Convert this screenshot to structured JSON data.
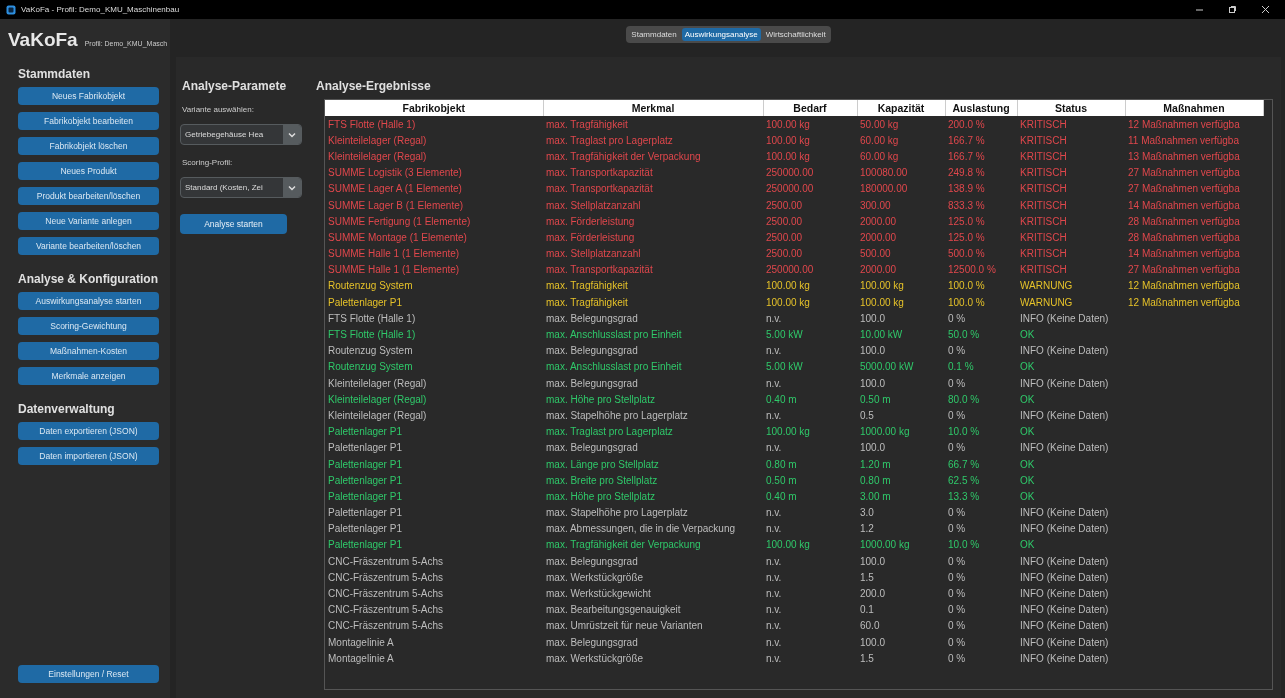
{
  "window": {
    "title": "VaKoFa - Profil: Demo_KMU_Maschinenbau"
  },
  "sidebar": {
    "app_name": "VaKoFa",
    "profile": "Profil: Demo_KMU_Masch",
    "sections": [
      {
        "title": "Stammdaten",
        "buttons": [
          "Neues Fabrikobjekt",
          "Fabrikobjekt bearbeiten",
          "Fabrikobjekt löschen",
          "Neues Produkt",
          "Produkt bearbeiten/löschen",
          "Neue Variante anlegen",
          "Variante bearbeiten/löschen"
        ]
      },
      {
        "title": "Analyse & Konfiguration",
        "buttons": [
          "Auswirkungsanalyse starten",
          "Scoring-Gewichtung",
          "Maßnahmen-Kosten",
          "Merkmale anzeigen"
        ]
      },
      {
        "title": "Datenverwaltung",
        "buttons": [
          "Daten exportieren (JSON)",
          "Daten importieren (JSON)"
        ]
      }
    ],
    "footer_button": "Einstellungen / Reset"
  },
  "tabs": [
    {
      "label": "Stammdaten",
      "selected": false
    },
    {
      "label": "Auswirkungsanalyse",
      "selected": true
    },
    {
      "label": "Wirtschaftlichkeit",
      "selected": false
    }
  ],
  "parameters": {
    "title": "Analyse-Paramete",
    "fields": [
      {
        "label": "Variante auswählen:",
        "value": "Getriebegehäuse Hea"
      },
      {
        "label": "Scoring-Profil:",
        "value": "Standard (Kosten, Zei"
      }
    ],
    "button": "Analyse starten"
  },
  "results": {
    "title": "Analyse-Ergebnisse",
    "columns": [
      "Fabrikobjekt",
      "Merkmal",
      "Bedarf",
      "Kapazität",
      "Auslastung",
      "Status",
      "Maßnahmen"
    ],
    "rows": [
      {
        "kind": "critical",
        "cells": [
          "FTS Flotte (Halle 1)",
          "max. Tragfähigkeit",
          "100.00 kg",
          "50.00 kg",
          "200.0 %",
          "KRITISCH",
          "12 Maßnahmen verfügba"
        ]
      },
      {
        "kind": "critical",
        "cells": [
          "Kleinteilelager (Regal)",
          "max. Traglast pro Lagerplatz",
          "100.00 kg",
          "60.00 kg",
          "166.7 %",
          "KRITISCH",
          "11 Maßnahmen verfügba"
        ]
      },
      {
        "kind": "critical",
        "cells": [
          "Kleinteilelager (Regal)",
          "max. Tragfähigkeit der Verpackung",
          "100.00 kg",
          "60.00 kg",
          "166.7 %",
          "KRITISCH",
          "13 Maßnahmen verfügba"
        ]
      },
      {
        "kind": "critical",
        "cells": [
          "SUMME Logistik (3 Elemente)",
          "max. Transportkapazität",
          "250000.00",
          "100080.00",
          "249.8 %",
          "KRITISCH",
          "27 Maßnahmen verfügba"
        ]
      },
      {
        "kind": "critical",
        "cells": [
          "SUMME Lager A (1 Elemente)",
          "max. Transportkapazität",
          "250000.00",
          "180000.00",
          "138.9 %",
          "KRITISCH",
          "27 Maßnahmen verfügba"
        ]
      },
      {
        "kind": "critical",
        "cells": [
          "SUMME Lager B (1 Elemente)",
          "max. Stellplatzanzahl",
          "2500.00",
          "300.00",
          "833.3 %",
          "KRITISCH",
          "14 Maßnahmen verfügba"
        ]
      },
      {
        "kind": "critical",
        "cells": [
          "SUMME Fertigung (1 Elemente)",
          "max. Förderleistung",
          "2500.00",
          "2000.00",
          "125.0 %",
          "KRITISCH",
          "28 Maßnahmen verfügba"
        ]
      },
      {
        "kind": "critical",
        "cells": [
          "SUMME Montage (1 Elemente)",
          "max. Förderleistung",
          "2500.00",
          "2000.00",
          "125.0 %",
          "KRITISCH",
          "28 Maßnahmen verfügba"
        ]
      },
      {
        "kind": "critical",
        "cells": [
          "SUMME Halle 1 (1 Elemente)",
          "max. Stellplatzanzahl",
          "2500.00",
          "500.00",
          "500.0 %",
          "KRITISCH",
          "14 Maßnahmen verfügba"
        ]
      },
      {
        "kind": "critical",
        "cells": [
          "SUMME Halle 1 (1 Elemente)",
          "max. Transportkapazität",
          "250000.00",
          "2000.00",
          "12500.0 %",
          "KRITISCH",
          "27 Maßnahmen verfügba"
        ]
      },
      {
        "kind": "warning",
        "cells": [
          "Routenzug System",
          "max. Tragfähigkeit",
          "100.00 kg",
          "100.00 kg",
          "100.0 %",
          "WARNUNG",
          "12 Maßnahmen verfügba"
        ]
      },
      {
        "kind": "warning",
        "cells": [
          "Palettenlager P1",
          "max. Tragfähigkeit",
          "100.00 kg",
          "100.00 kg",
          "100.0 %",
          "WARNUNG",
          "12 Maßnahmen verfügba"
        ]
      },
      {
        "kind": "info",
        "cells": [
          "FTS Flotte (Halle 1)",
          "max. Belegungsgrad",
          "n.v.",
          "100.0",
          "0 %",
          "INFO (Keine Daten)"
        ]
      },
      {
        "kind": "ok",
        "cells": [
          "FTS Flotte (Halle 1)",
          "max. Anschlusslast pro Einheit",
          "5.00 kW",
          "10.00 kW",
          "50.0 %",
          "OK"
        ]
      },
      {
        "kind": "info",
        "cells": [
          "Routenzug System",
          "max. Belegungsgrad",
          "n.v.",
          "100.0",
          "0 %",
          "INFO (Keine Daten)"
        ]
      },
      {
        "kind": "ok",
        "cells": [
          "Routenzug System",
          "max. Anschlusslast pro Einheit",
          "5.00 kW",
          "5000.00 kW",
          "0.1 %",
          "OK"
        ]
      },
      {
        "kind": "info",
        "cells": [
          "Kleinteilelager (Regal)",
          "max. Belegungsgrad",
          "n.v.",
          "100.0",
          "0 %",
          "INFO (Keine Daten)"
        ]
      },
      {
        "kind": "ok",
        "cells": [
          "Kleinteilelager (Regal)",
          "max. Höhe pro Stellplatz",
          "0.40 m",
          "0.50 m",
          "80.0 %",
          "OK"
        ]
      },
      {
        "kind": "info",
        "cells": [
          "Kleinteilelager (Regal)",
          "max. Stapelhöhe pro Lagerplatz",
          "n.v.",
          "0.5",
          "0 %",
          "INFO (Keine Daten)"
        ]
      },
      {
        "kind": "ok",
        "cells": [
          "Palettenlager P1",
          "max. Traglast pro Lagerplatz",
          "100.00 kg",
          "1000.00 kg",
          "10.0 %",
          "OK"
        ]
      },
      {
        "kind": "info",
        "cells": [
          "Palettenlager P1",
          "max. Belegungsgrad",
          "n.v.",
          "100.0",
          "0 %",
          "INFO (Keine Daten)"
        ]
      },
      {
        "kind": "ok",
        "cells": [
          "Palettenlager P1",
          "max. Länge pro Stellplatz",
          "0.80 m",
          "1.20 m",
          "66.7 %",
          "OK"
        ]
      },
      {
        "kind": "ok",
        "cells": [
          "Palettenlager P1",
          "max. Breite pro Stellplatz",
          "0.50 m",
          "0.80 m",
          "62.5 %",
          "OK"
        ]
      },
      {
        "kind": "ok",
        "cells": [
          "Palettenlager P1",
          "max. Höhe pro Stellplatz",
          "0.40 m",
          "3.00 m",
          "13.3 %",
          "OK"
        ]
      },
      {
        "kind": "info",
        "cells": [
          "Palettenlager P1",
          "max. Stapelhöhe pro Lagerplatz",
          "n.v.",
          "3.0",
          "0 %",
          "INFO (Keine Daten)"
        ]
      },
      {
        "kind": "info",
        "cells": [
          "Palettenlager P1",
          "max. Abmessungen, die in die Verpackung",
          "n.v.",
          "1.2",
          "0 %",
          "INFO (Keine Daten)"
        ]
      },
      {
        "kind": "ok",
        "cells": [
          "Palettenlager P1",
          "max. Tragfähigkeit der Verpackung",
          "100.00 kg",
          "1000.00 kg",
          "10.0 %",
          "OK"
        ]
      },
      {
        "kind": "info",
        "cells": [
          "CNC-Fräszentrum 5-Achs",
          "max. Belegungsgrad",
          "n.v.",
          "100.0",
          "0 %",
          "INFO (Keine Daten)"
        ]
      },
      {
        "kind": "info",
        "cells": [
          "CNC-Fräszentrum 5-Achs",
          "max. Werkstückgröße",
          "n.v.",
          "1.5",
          "0 %",
          "INFO (Keine Daten)"
        ]
      },
      {
        "kind": "info",
        "cells": [
          "CNC-Fräszentrum 5-Achs",
          "max. Werkstückgewicht",
          "n.v.",
          "200.0",
          "0 %",
          "INFO (Keine Daten)"
        ]
      },
      {
        "kind": "info",
        "cells": [
          "CNC-Fräszentrum 5-Achs",
          "max. Bearbeitungsgenauigkeit",
          "n.v.",
          "0.1",
          "0 %",
          "INFO (Keine Daten)"
        ]
      },
      {
        "kind": "info",
        "cells": [
          "CNC-Fräszentrum 5-Achs",
          "max. Umrüstzeit für neue Varianten",
          "n.v.",
          "60.0",
          "0 %",
          "INFO (Keine Daten)"
        ]
      },
      {
        "kind": "info",
        "cells": [
          "Montagelinie A",
          "max. Belegungsgrad",
          "n.v.",
          "100.0",
          "0 %",
          "INFO (Keine Daten)"
        ]
      },
      {
        "kind": "info",
        "cells": [
          "Montagelinie A",
          "max. Werkstückgröße",
          "n.v.",
          "1.5",
          "0 %",
          "INFO (Keine Daten)"
        ]
      }
    ]
  }
}
